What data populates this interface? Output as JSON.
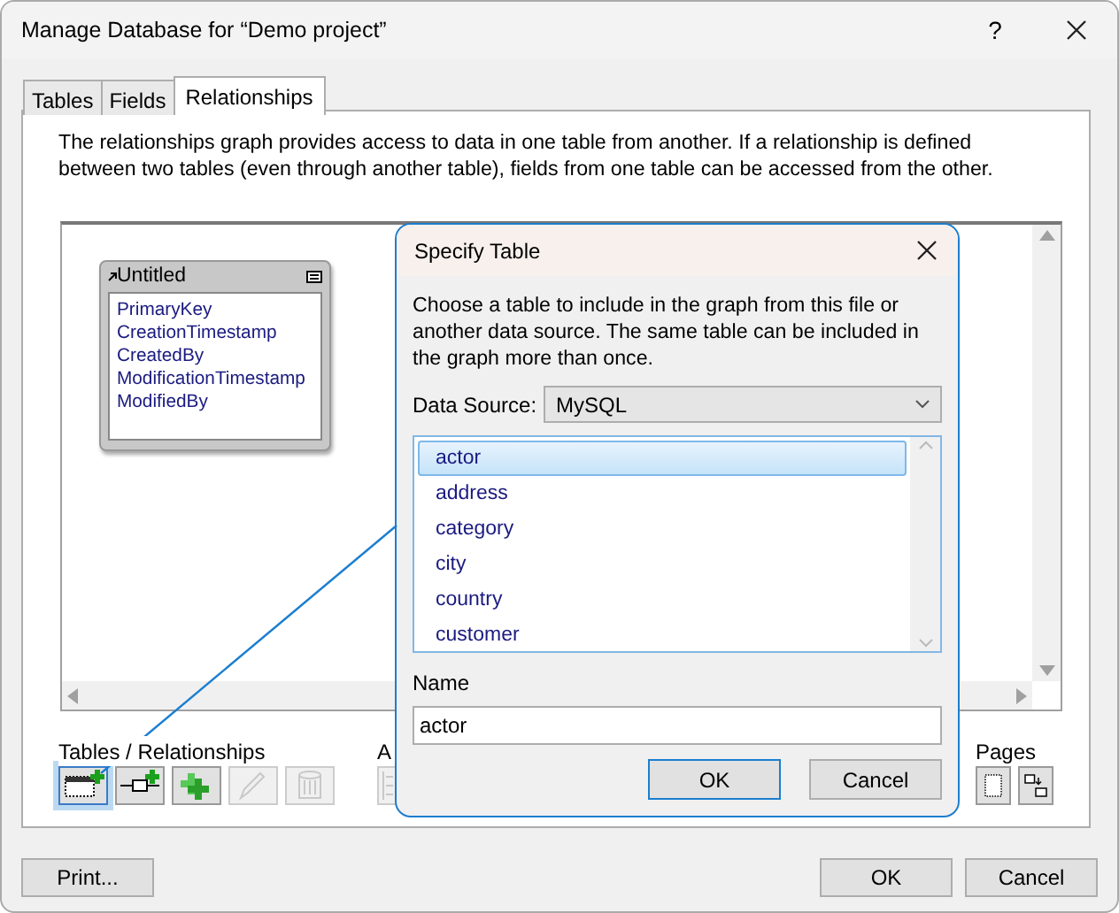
{
  "window": {
    "title": "Manage Database for “Demo project”",
    "help": "?"
  },
  "tabs": [
    {
      "label": "Tables",
      "selected": false
    },
    {
      "label": "Fields",
      "selected": false
    },
    {
      "label": "Relationships",
      "selected": true
    }
  ],
  "description": "The relationships graph provides access to data in one table from another. If a relationship is defined between two tables (even through another table), fields from one table can be accessed from the other.",
  "graph": {
    "tables": [
      {
        "name": "Untitled",
        "fields": [
          "PrimaryKey",
          "CreationTimestamp",
          "CreatedBy",
          "ModificationTimestamp",
          "ModifiedBy"
        ]
      }
    ]
  },
  "toolbar": [
    {
      "label": "Tables / Relationships",
      "buttons": [
        {
          "kind": "add-table",
          "disabled": false,
          "selected": true
        },
        {
          "kind": "add-relationship",
          "disabled": false,
          "selected": false
        },
        {
          "kind": "duplicate",
          "disabled": false,
          "selected": false
        },
        {
          "kind": "edit",
          "disabled": true,
          "selected": false
        },
        {
          "kind": "delete",
          "disabled": true,
          "selected": false
        }
      ]
    },
    {
      "label": "A",
      "buttons": [
        {
          "kind": "align"
        }
      ]
    },
    {
      "label": "Pages",
      "buttons": [
        {
          "kind": "page-setup",
          "disabled": false,
          "selected": false
        },
        {
          "kind": "page-size",
          "disabled": false,
          "selected": false
        }
      ]
    }
  ],
  "dialog": {
    "title": "Specify Table",
    "description": "Choose a table to include in the graph from this file or another data source. The same table can be included in the graph more than once.",
    "data_source_label": "Data Source:",
    "data_source": "MySQL",
    "tables": [
      {
        "name": "actor",
        "selected": true
      },
      {
        "name": "address",
        "selected": false
      },
      {
        "name": "category",
        "selected": false
      },
      {
        "name": "city",
        "selected": false
      },
      {
        "name": "country",
        "selected": false
      },
      {
        "name": "customer",
        "selected": false
      }
    ],
    "name_label": "Name",
    "name_value": "actor",
    "buttons": [
      "OK",
      "Cancel"
    ]
  },
  "footer": {
    "left": [
      "Print..."
    ],
    "right": [
      "OK",
      "Cancel"
    ]
  }
}
